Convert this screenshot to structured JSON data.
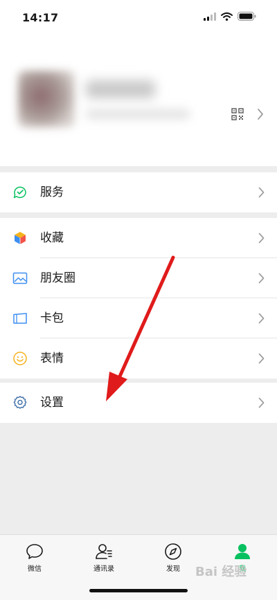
{
  "status_bar": {
    "time": "14:17"
  },
  "menu": {
    "services": {
      "label": "服务",
      "icon": "services-icon"
    },
    "favorites": {
      "label": "收藏",
      "icon": "favorites-cube-icon"
    },
    "moments": {
      "label": "朋友圈",
      "icon": "moments-image-icon"
    },
    "cards": {
      "label": "卡包",
      "icon": "card-wallet-icon"
    },
    "stickers": {
      "label": "表情",
      "icon": "smiley-icon"
    },
    "settings": {
      "label": "设置",
      "icon": "gear-icon"
    }
  },
  "tabs": [
    {
      "label": "微信",
      "icon": "chat-bubble-icon",
      "active": false
    },
    {
      "label": "通讯录",
      "icon": "contacts-icon",
      "active": false
    },
    {
      "label": "发现",
      "icon": "compass-icon",
      "active": false
    },
    {
      "label": "我",
      "icon": "person-icon",
      "active": true
    }
  ],
  "colors": {
    "accent": "#07c160",
    "annotation": "#e01b1b",
    "background": "#ededed"
  },
  "watermark": "Bai 经验"
}
